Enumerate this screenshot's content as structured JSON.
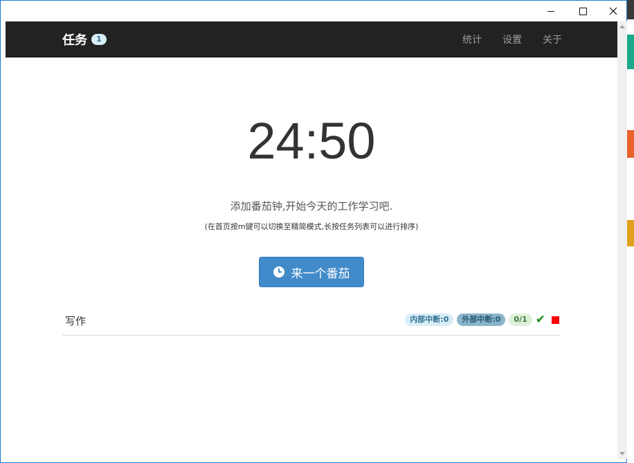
{
  "window": {
    "controls": {
      "minimize": "minimize",
      "maximize": "maximize",
      "close": "close"
    }
  },
  "navbar": {
    "brand": "任务",
    "badge": "1",
    "links": [
      "统计",
      "设置",
      "关于"
    ]
  },
  "main": {
    "timer": "24:50",
    "subtitle": "添加番茄钟,开始今天的工作学习吧.",
    "hint": "(在首页按m键可以切换至精简模式,长按任务列表可以进行排序)",
    "add_button": "来一个番茄"
  },
  "tasks": [
    {
      "name": "写作",
      "internal_interrupt": "内部中断:0",
      "external_interrupt": "外部中断:0",
      "progress": "0/1"
    }
  ],
  "colors": {
    "navbar": "#222222",
    "primary_button": "#428bca",
    "check": "#1a8a1a",
    "stop": "#ff0000"
  },
  "icons": {
    "timer_button": "clock-icon",
    "complete": "check-icon",
    "stop": "stop-icon"
  }
}
